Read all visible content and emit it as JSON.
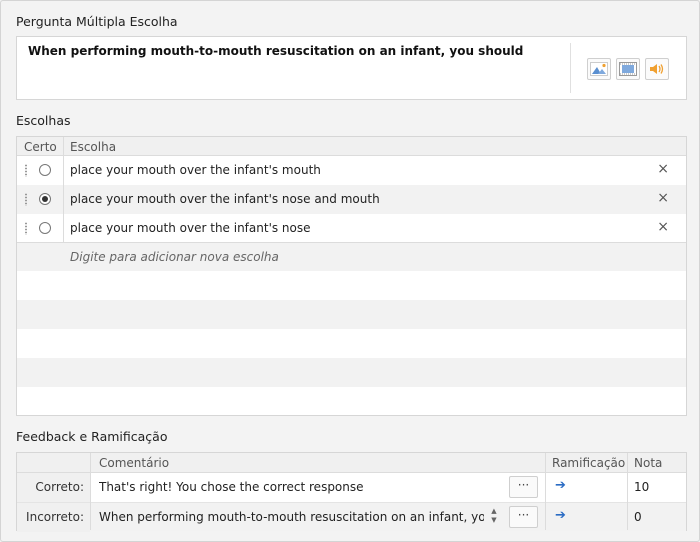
{
  "question_section": {
    "title": "Pergunta Múltipla Escolha",
    "text": "When performing mouth-to-mouth resuscitation on an infant, you should",
    "media_buttons": [
      {
        "icon": "image-icon"
      },
      {
        "icon": "video-icon"
      },
      {
        "icon": "audio-icon"
      }
    ]
  },
  "choices_section": {
    "title": "Escolhas",
    "columns": {
      "correct": "Certo",
      "choice": "Escolha"
    },
    "rows": [
      {
        "text": "place your mouth over the infant's mouth",
        "correct": false
      },
      {
        "text": "place your mouth over the infant's nose and mouth",
        "correct": true
      },
      {
        "text": "place your mouth over the infant's nose",
        "correct": false
      }
    ],
    "delete_symbol": "×",
    "add_placeholder": "Digite para adicionar nova escolha"
  },
  "feedback_section": {
    "title": "Feedback e Ramificação",
    "columns": {
      "comment": "Comentário",
      "branching": "Ramificação",
      "score": "Nota"
    },
    "rows": [
      {
        "label": "Correto:",
        "comment": "That's right! You chose the correct response",
        "score": "10"
      },
      {
        "label": "Incorreto:",
        "comment": "When performing mouth-to-mouth resuscitation on an infant, you",
        "score": "0"
      }
    ],
    "more_symbol": "···",
    "branch_symbol": "➔"
  },
  "colors": {
    "accent": "#2b6cc4",
    "media_icon": "#f0a030"
  }
}
